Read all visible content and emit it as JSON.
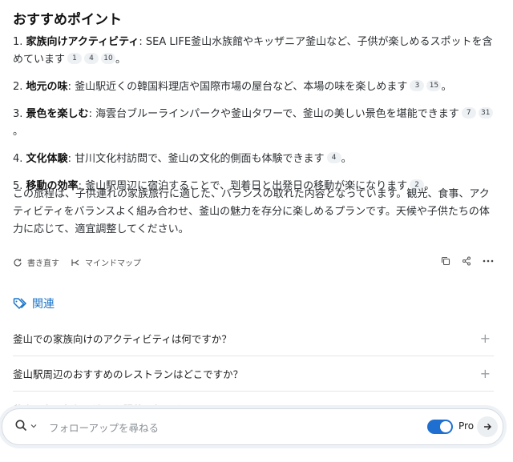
{
  "section_title": "おすすめポイント",
  "points": [
    {
      "num": "1.",
      "bold": "家族向けアクティビティ",
      "text": ": SEA LIFE釜山水族館やキッザニア釜山など、子供が楽しめるスポットを含めています",
      "cites": [
        "1",
        "4",
        "10"
      ],
      "end": "。"
    },
    {
      "num": "2.",
      "bold": "地元の味",
      "text": ": 釜山駅近くの韓国料理店や国際市場の屋台など、本場の味を楽しめます",
      "cites": [
        "3",
        "15"
      ],
      "end": "。"
    },
    {
      "num": "3.",
      "bold": "景色を楽しむ",
      "text": ": 海雲台ブルーラインパークや釜山タワーで、釜山の美しい景色を堪能できます",
      "cites": [
        "7",
        "31"
      ],
      "end": "。"
    },
    {
      "num": "4.",
      "bold": "文化体験",
      "text": ": 甘川文化村訪問で、釜山の文化的側面も体験できます",
      "cites": [
        "4"
      ],
      "end": "。"
    },
    {
      "num": "5.",
      "bold": "移動の効率",
      "text": ": 釜山駅周辺に宿泊することで、到着日と出発日の移動が楽になります",
      "cites": [
        "2"
      ],
      "end": "。"
    }
  ],
  "summary": "この旅程は、子供連れの家族旅行に適した、バランスの取れた内容となっています。観光、食事、アクティビティをバランスよく組み合わせ、釜山の魅力を存分に楽しめるプランです。天候や子供たちの体力に応じて、適宜調整してください。",
  "actions": {
    "rewrite": "書き直す",
    "mindmap": "マインドマップ"
  },
  "related": {
    "title": "関連",
    "items": [
      "釜山での家族向けのアクティビティは何ですか？",
      "釜山駅周辺のおすすめのレストランはどこですか？",
      "釜山の冬の気候に適した服装は何ですか？"
    ]
  },
  "followup": {
    "placeholder": "フォローアップを尋ねる",
    "pro_label": "Pro"
  },
  "colors": {
    "accent": "#1a73c9",
    "toggle": "#1f6fd1"
  }
}
